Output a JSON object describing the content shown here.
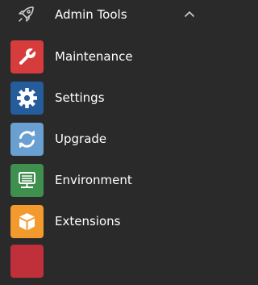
{
  "menu": {
    "section_title": "Admin Tools",
    "section_icon": "rocket-icon",
    "expanded": true,
    "items": [
      {
        "label": "Maintenance",
        "icon": "wrench-icon",
        "color": "#d63c3c"
      },
      {
        "label": "Settings",
        "icon": "gear-icon",
        "color": "#245c9c"
      },
      {
        "label": "Upgrade",
        "icon": "refresh-icon",
        "color": "#6a9fd1"
      },
      {
        "label": "Environment",
        "icon": "server-icon",
        "color": "#3f8f4f"
      },
      {
        "label": "Extensions",
        "icon": "cube-icon",
        "color": "#f29a2e"
      },
      {
        "label": "",
        "icon": "",
        "color": "#c0303a"
      }
    ]
  }
}
